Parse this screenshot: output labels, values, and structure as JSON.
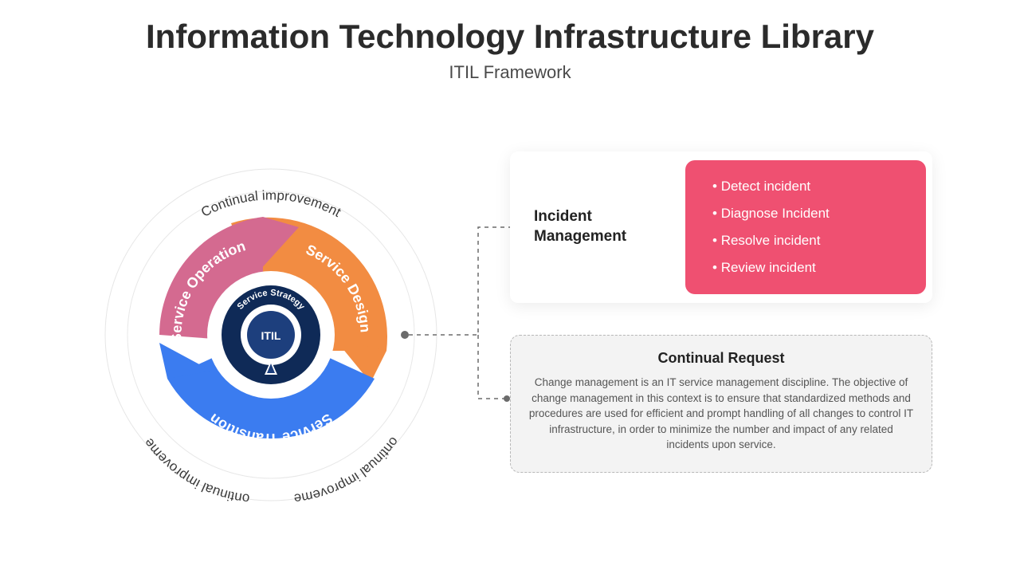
{
  "title": "Information Technology Infrastructure Library",
  "subtitle": "ITIL Framework",
  "diagram": {
    "outer_label": "Continual improvement",
    "arcs": {
      "design": {
        "label": "Service Design",
        "color": "#f28c42"
      },
      "transition": {
        "label": "Service Transition",
        "color": "#3b7cf0"
      },
      "operation": {
        "label": "Service Operation",
        "color": "#d46a90"
      }
    },
    "core": {
      "strategy_label": "Service Strategy",
      "center_label": "ITIL",
      "ring_colors": {
        "outer": "#0f2a57",
        "inner": "#1d3f7d"
      }
    }
  },
  "card1": {
    "heading": "Incident Management",
    "items": [
      "Detect incident",
      "Diagnose Incident",
      "Resolve incident",
      "Review incident"
    ]
  },
  "card2": {
    "heading": "Continual Request",
    "body": "Change management is an IT service management discipline. The objective of change management in this context is to ensure that standardized methods and procedures are used for efficient and prompt handling of all changes to control IT infrastructure, in order to minimize the number and impact of any related incidents upon service."
  },
  "colors": {
    "accent_pink": "#ef5071",
    "panel_grey": "#f3f3f3"
  }
}
